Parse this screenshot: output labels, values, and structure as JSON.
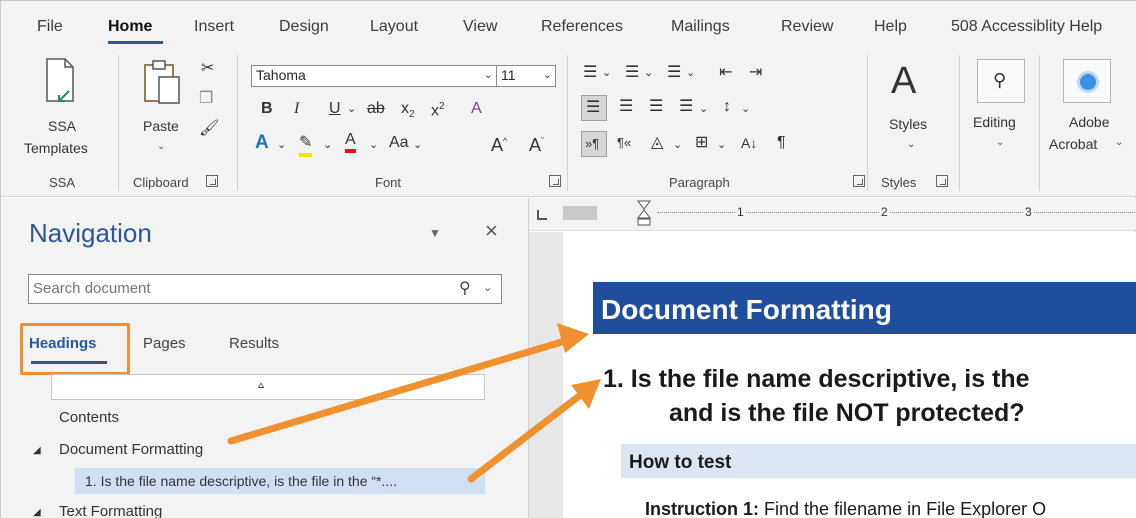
{
  "menu": {
    "items": [
      {
        "label": "File",
        "active": false
      },
      {
        "label": "Home",
        "active": true
      },
      {
        "label": "Insert",
        "active": false
      },
      {
        "label": "Design",
        "active": false
      },
      {
        "label": "Layout",
        "active": false
      },
      {
        "label": "View",
        "active": false
      },
      {
        "label": "References",
        "active": false
      },
      {
        "label": "Mailings",
        "active": false
      },
      {
        "label": "Review",
        "active": false
      },
      {
        "label": "Help",
        "active": false
      },
      {
        "label": "508 Accessiblity Help",
        "active": false
      }
    ]
  },
  "ribbon": {
    "ssa": {
      "button_line1": "SSA",
      "button_line2": "Templates",
      "group_label": "SSA"
    },
    "clipboard": {
      "paste_label": "Paste",
      "group_label": "Clipboard"
    },
    "font": {
      "font_name": "Tahoma",
      "font_size": "11",
      "change_case": "Aa",
      "group_label": "Font"
    },
    "paragraph": {
      "group_label": "Paragraph"
    },
    "styles": {
      "styles_label": "Styles",
      "group_label": "Styles"
    },
    "editing": {
      "label": "Editing"
    },
    "adobe": {
      "line1": "Adobe",
      "line2": "Acrobat"
    }
  },
  "ruler": {
    "marks": [
      "1",
      "2",
      "3"
    ]
  },
  "navigation": {
    "title": "Navigation",
    "search_placeholder": "Search document",
    "tabs": [
      "Headings",
      "Pages",
      "Results"
    ],
    "active_tab": "Headings",
    "items": [
      {
        "label": "Contents",
        "level": 1,
        "expander": ""
      },
      {
        "label": "Document Formatting",
        "level": 1,
        "expander": "◢"
      },
      {
        "label": "1. Is the file name descriptive, is the file in the “*....",
        "level": 2,
        "expander": "",
        "selected": true
      },
      {
        "label": "Text Formatting",
        "level": 1,
        "expander": "◢"
      }
    ]
  },
  "document": {
    "heading1": "Document Formatting",
    "question_line1": "1.   Is the file name descriptive, is the",
    "question_line2": "and is the file NOT protected?",
    "heading3": "How to test",
    "instruction_label": "Instruction 1:",
    "instruction_text": " Find the filename in File Explorer O"
  },
  "colors": {
    "accent": "#2b579a",
    "heading_fill": "#1f4e9c",
    "callout_orange": "#f0912f",
    "selection": "#cfe0f5"
  }
}
